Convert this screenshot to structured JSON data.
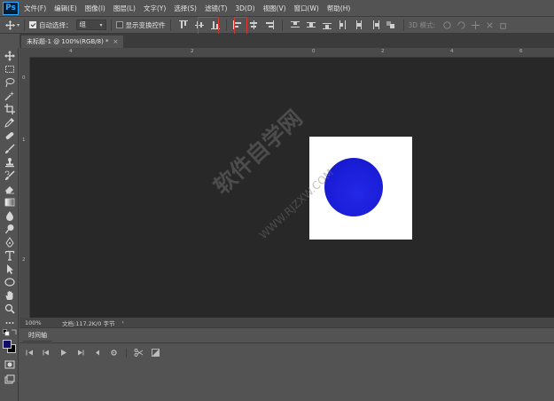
{
  "app": {
    "logo": "Ps"
  },
  "menu": {
    "items": [
      "文件(F)",
      "编辑(E)",
      "图像(I)",
      "图层(L)",
      "文字(Y)",
      "选择(S)",
      "滤镜(T)",
      "3D(D)",
      "视图(V)",
      "窗口(W)",
      "帮助(H)"
    ]
  },
  "options": {
    "auto_select_label": "自动选择：",
    "auto_select_checked": true,
    "group_value": "组",
    "show_transform_label": "显示变换控件",
    "show_transform_checked": false,
    "mode_3d_label": "3D 模式:"
  },
  "document": {
    "tab_title": "未标题-1 @ 100%(RGB/8) *",
    "canvas_color": "#ffffff",
    "circle_color": "#1c1ed8"
  },
  "rulers": {
    "top_numbers": [
      "4",
      "2",
      "0",
      "2",
      "4",
      "6"
    ],
    "left_numbers": [
      "0",
      "1",
      "2"
    ]
  },
  "status": {
    "zoom": "100%",
    "doc_info": "文档:117.2K/0 字节"
  },
  "timeline": {
    "tab_label": "时间轴"
  },
  "colors": {
    "foreground": "#130d6a",
    "background": "#000000",
    "highlight": "#e0352b"
  },
  "watermark": {
    "text": "软件自学网",
    "sub": "WWW.RJZXW.COM"
  }
}
